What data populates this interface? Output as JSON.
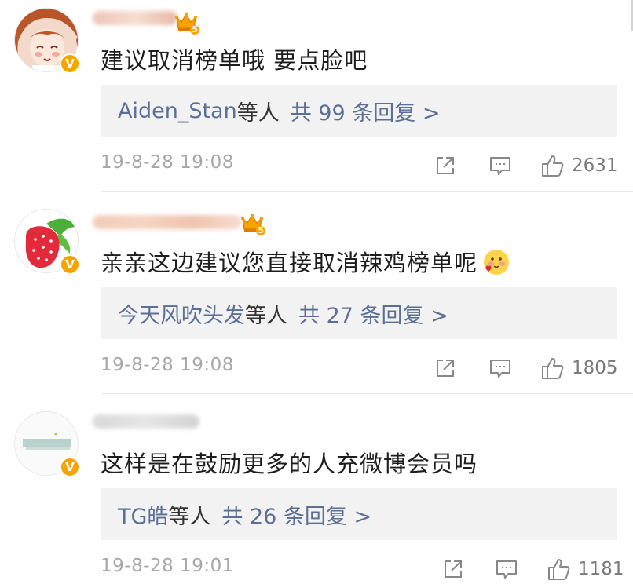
{
  "comments": [
    {
      "text": "建议取消榜单哦 要点脸吧",
      "reply_names": "Aiden_Stan",
      "reply_etc": "等人",
      "reply_total": "共 99 条回复 >",
      "date": "19-8-28 19:08",
      "likes": "2631",
      "level": "5",
      "verified": "V"
    },
    {
      "text": "亲亲这边建议您直接取消辣鸡榜单呢",
      "reply_names": "今天风吹头发",
      "reply_etc": "等人",
      "reply_total": "共 27 条回复 >",
      "date": "19-8-28 19:08",
      "likes": "1805",
      "level": "5",
      "verified": "V"
    },
    {
      "text": "这样是在鼓励更多的人充微博会员吗",
      "reply_names": "TG皓",
      "reply_etc": "等人",
      "reply_total": "共 26 条回复 >",
      "date": "19-8-28 19:01",
      "likes": "1181",
      "verified": "V"
    }
  ],
  "colors": {
    "link": "#5b6f94",
    "verified_badge": "#f7a400",
    "reply_bg": "#f2f2f2"
  },
  "icons": [
    "share-icon",
    "comment-icon",
    "thumbs-up-icon",
    "crown-icon",
    "verified-icon"
  ]
}
